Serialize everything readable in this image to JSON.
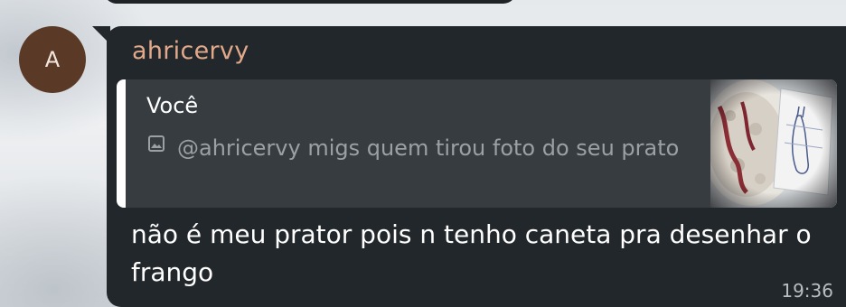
{
  "message": {
    "avatar_initial": "A",
    "sender": "ahricervy",
    "reply": {
      "author": "Você",
      "icon": "image-icon",
      "text": "@ahricervy migs quem tirou foto do seu prato"
    },
    "text": "não é meu prator pois n tenho caneta pra desenhar o frango",
    "time": "19:36"
  },
  "colors": {
    "bubble": "#22272b",
    "reply_bg": "#373c40",
    "sender": "#e2a88a",
    "avatar": "#5a3a26"
  }
}
